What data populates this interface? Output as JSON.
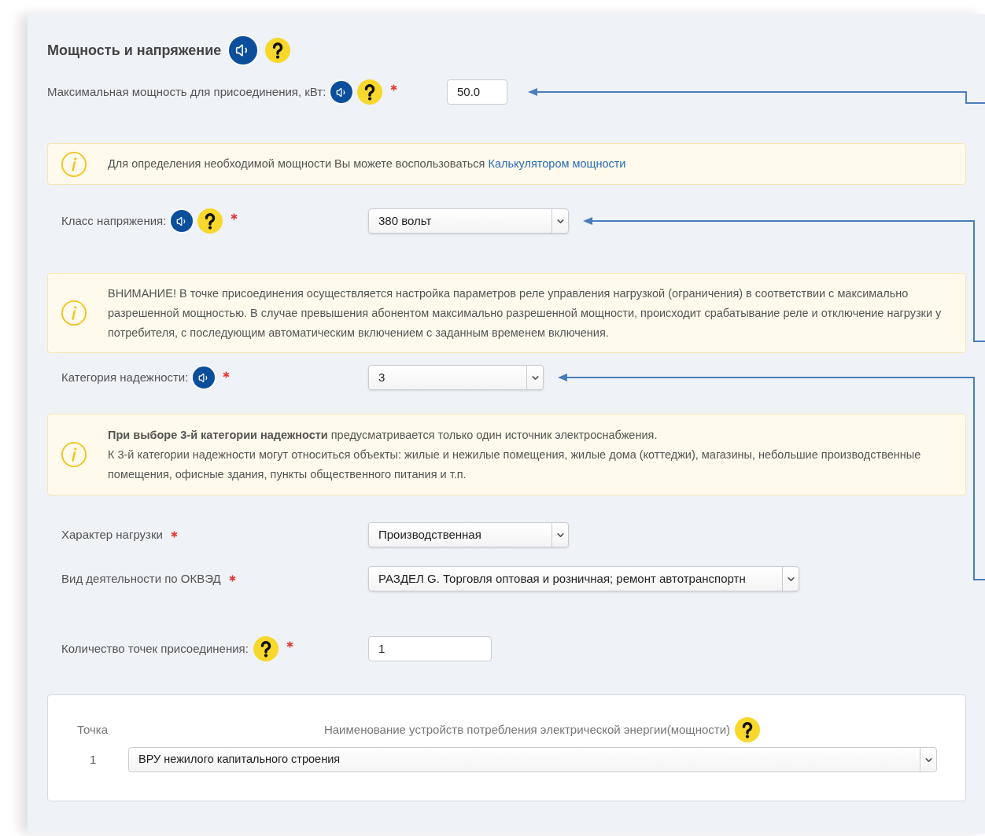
{
  "section": {
    "title": "Мощность и напряжение",
    "speaker": true,
    "help": true
  },
  "blocks": [
    {
      "kind": "lead_field",
      "control": {
        "kind": "input",
        "value": "50.0"
      },
      "label": "Максимальная мощность для присоединения, кВт:",
      "speaker": true,
      "help": true,
      "required": true,
      "arrow": true
    },
    {
      "kind": "note",
      "paragraphs": [
        "Для определения необходимой мощности Вы можете воспользоваться"
      ],
      "link": "Калькулятором мощности"
    },
    {
      "kind": "field",
      "control": {
        "kind": "select",
        "value": "380 вольт"
      },
      "label": "Класс напряжения:",
      "speaker": true,
      "help": true,
      "required": true,
      "arrow": true
    },
    {
      "kind": "note",
      "paragraphs": [
        "ВНИМАНИЕ! В точке присоединения осуществляется настройка параметров реле управления нагрузкой (ограничения) в соответствии с максимально разрешенной мощностью. В случае превышения абонентом максимально разрешенной мощности, происходит срабатывание реле и отключение нагрузки у потребителя, с последующим автоматическим включением с заданным временем включения."
      ]
    },
    {
      "kind": "field",
      "control": {
        "kind": "select",
        "value": "3"
      },
      "label": "Категория надежности:",
      "speaker": true,
      "help": false,
      "required": true,
      "arrow": true
    },
    {
      "kind": "note",
      "paragraphs": [
        "**При выборе 3-й категории надежности** предусматривается только один источник электроснабжения.",
        "К 3-й категории надежности могут относиться объекты: жилые и нежилые помещения, жилые дома (коттеджи), магазины, небольшие производственные помещения, офисные здания, пункты общественного питания и т.п."
      ]
    },
    {
      "kind": "field",
      "control": {
        "kind": "select",
        "value": "Производственная"
      },
      "label": "Характер нагрузки",
      "speaker": false,
      "help": false,
      "required": true,
      "arrow": false
    },
    {
      "kind": "field",
      "control": {
        "kind": "select",
        "value": "РАЗДЕЛ G. Торговля оптовая и розничная; ремонт автотранспортн"
      },
      "label": "Вид деятельности по ОКВЭД",
      "speaker": false,
      "help": false,
      "required": true,
      "arrow": false
    },
    {
      "kind": "field",
      "control": {
        "kind": "input",
        "value": "1"
      },
      "label": "Количество точек присоединения:",
      "speaker": false,
      "help": true,
      "required": true,
      "arrow": false
    }
  ],
  "table": {
    "columns": [
      "Точка",
      "Наименование устройств потребления электрической энергии(мощности)"
    ],
    "help": true,
    "rows": [
      {
        "point": "1",
        "device": "ВРУ нежилого капитального строения"
      }
    ]
  }
}
